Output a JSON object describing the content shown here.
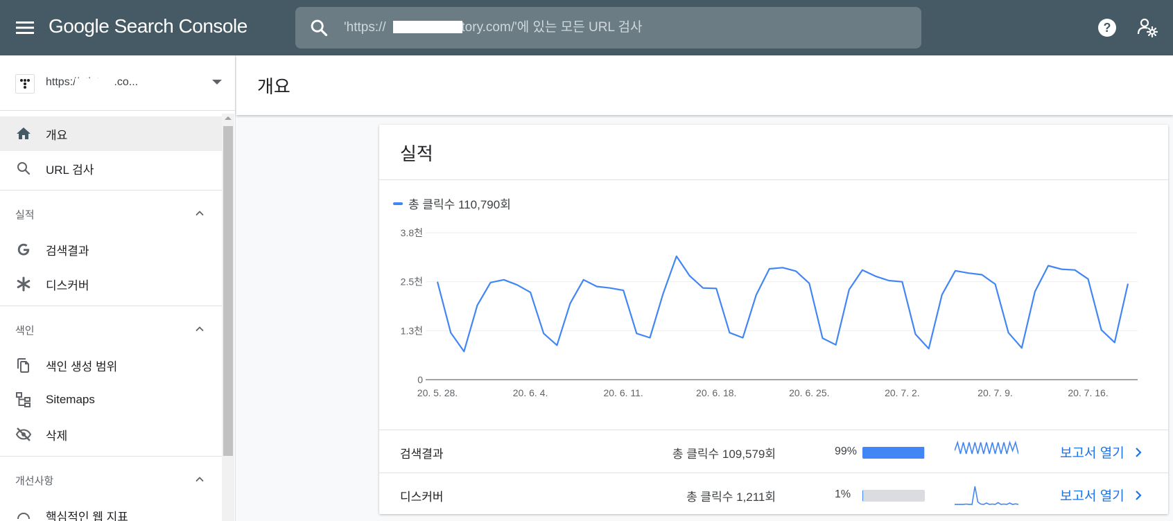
{
  "app": {
    "title": "Google Search Console",
    "search_placeholder": "'https://                ,tistory.com/'에 있는 모든 URL 검사"
  },
  "sidebar": {
    "property_url": "https://                  .tistory.co...",
    "items": [
      {
        "label": "개요",
        "icon": "home-icon",
        "active": true
      },
      {
        "label": "URL 검사",
        "icon": "search-icon"
      }
    ],
    "sections": [
      {
        "label": "실적",
        "items": [
          {
            "label": "검색결과",
            "icon": "google-g-icon"
          },
          {
            "label": "디스커버",
            "icon": "asterisk-icon"
          }
        ]
      },
      {
        "label": "색인",
        "items": [
          {
            "label": "색인 생성 범위",
            "icon": "copy-icon"
          },
          {
            "label": "Sitemaps",
            "icon": "sitemap-icon"
          },
          {
            "label": "삭제",
            "icon": "eye-off-icon"
          }
        ]
      },
      {
        "label": "개선사항",
        "items": [
          {
            "label": "핵심적인 웹 지표",
            "icon": "gauge-icon"
          }
        ]
      }
    ]
  },
  "page": {
    "title": "개요"
  },
  "card": {
    "title": "실적",
    "legend": "총 클릭수 110,790회",
    "rows": [
      {
        "name": "검색결과",
        "clicks": "총 클릭수 109,579회",
        "pct": "99%",
        "share": 0.99,
        "link": "보고서 열기"
      },
      {
        "name": "디스커버",
        "clicks": "총 클릭수 1,211회",
        "pct": "1%",
        "share": 0.01,
        "link": "보고서 열기"
      }
    ]
  },
  "colors": {
    "topbar": "#455a64",
    "accent": "#4285f4",
    "link": "#1a73e8"
  },
  "chart_data": {
    "type": "line",
    "title": "",
    "xlabel": "",
    "ylabel": "",
    "yticks": [
      "0",
      "1.3천",
      "2.5천",
      "3.8천"
    ],
    "ytick_values": [
      0,
      1250,
      2500,
      3750
    ],
    "ylim": [
      0,
      3750
    ],
    "xticks": [
      "20. 5. 28.",
      "20. 6. 4.",
      "20. 6. 11.",
      "20. 6. 18.",
      "20. 6. 25.",
      "20. 7. 2.",
      "20. 7. 9.",
      "20. 7. 16."
    ],
    "grid": true,
    "series": [
      {
        "name": "총 클릭수",
        "color": "#4285f4",
        "values": [
          2500,
          1200,
          720,
          1900,
          2480,
          2550,
          2420,
          2230,
          1180,
          880,
          1950,
          2550,
          2380,
          2340,
          2280,
          1180,
          1070,
          2200,
          3150,
          2650,
          2340,
          2330,
          1200,
          1070,
          2160,
          2830,
          2860,
          2770,
          2460,
          1060,
          890,
          2300,
          2800,
          2640,
          2530,
          2500,
          1160,
          790,
          2170,
          2780,
          2720,
          2680,
          2440,
          1200,
          810,
          2250,
          2910,
          2820,
          2800,
          2570,
          1270,
          950,
          2450
        ]
      }
    ]
  },
  "sparklines": {
    "search_results": [
      0.55,
      0.95,
      0.4,
      0.95,
      0.4,
      0.95,
      0.4,
      0.95,
      0.4,
      0.95,
      0.4,
      0.95,
      0.4,
      0.95,
      0.4,
      0.95,
      0.4,
      0.95,
      0.4,
      0.95,
      0.55,
      0.95,
      0.4
    ],
    "discover": [
      0.03,
      0.03,
      0.03,
      0.03,
      0.05,
      0.03,
      0.03,
      0.9,
      0.15,
      0.05,
      0.03,
      0.1,
      0.03,
      0.05,
      0.03,
      0.12,
      0.03,
      0.05,
      0.03,
      0.1,
      0.03,
      0.06,
      0.03
    ]
  }
}
